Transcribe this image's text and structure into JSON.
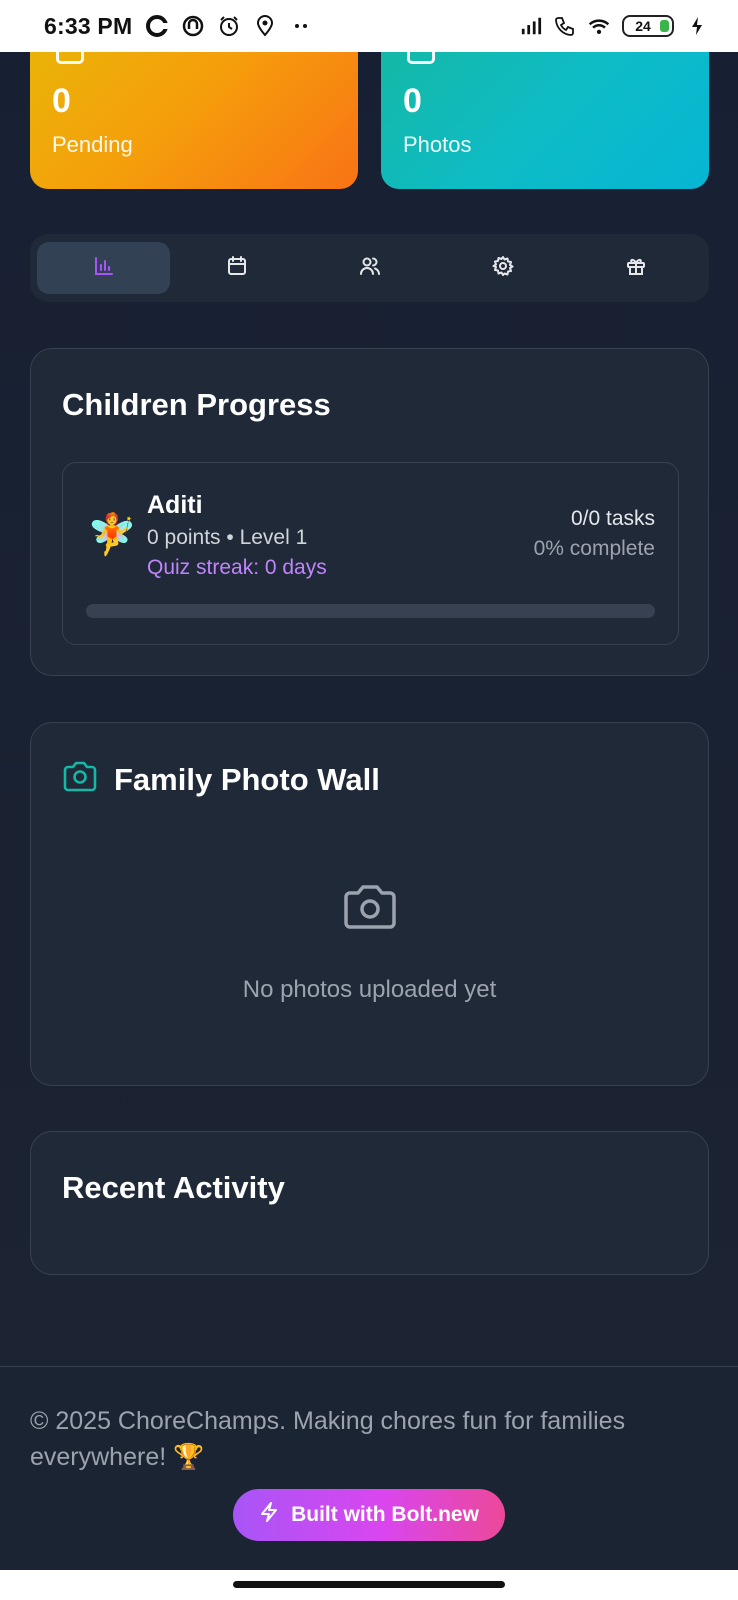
{
  "status_bar": {
    "time": "6:33 PM",
    "battery": "24"
  },
  "stats": {
    "pending": {
      "value": "0",
      "label": "Pending"
    },
    "photos": {
      "value": "0",
      "label": "Photos"
    }
  },
  "tabs": [
    {
      "icon": "bar-chart-icon",
      "active": true
    },
    {
      "icon": "calendar-icon",
      "active": false
    },
    {
      "icon": "users-icon",
      "active": false
    },
    {
      "icon": "gear-icon",
      "active": false
    },
    {
      "icon": "gift-icon",
      "active": false
    }
  ],
  "children_progress": {
    "title": "Children Progress",
    "children": [
      {
        "avatar": "🧚",
        "name": "Aditi",
        "points_level": "0 points • Level 1",
        "streak": "Quiz streak: 0 days",
        "tasks": "0/0 tasks",
        "complete": "0% complete",
        "progress": 0
      }
    ]
  },
  "photo_wall": {
    "title": "Family Photo Wall",
    "empty_text": "No photos uploaded yet"
  },
  "recent_activity": {
    "title": "Recent Activity"
  },
  "footer": {
    "text": "© 2025 ChoreChamps. Making chores fun for families everywhere! 🏆",
    "badge": "Built with Bolt.new"
  },
  "colors": {
    "accent_purple": "#a855f7",
    "pending_orange": "#f59e0b",
    "photos_teal": "#14b8a6",
    "panel_bg": "#1f2937"
  }
}
